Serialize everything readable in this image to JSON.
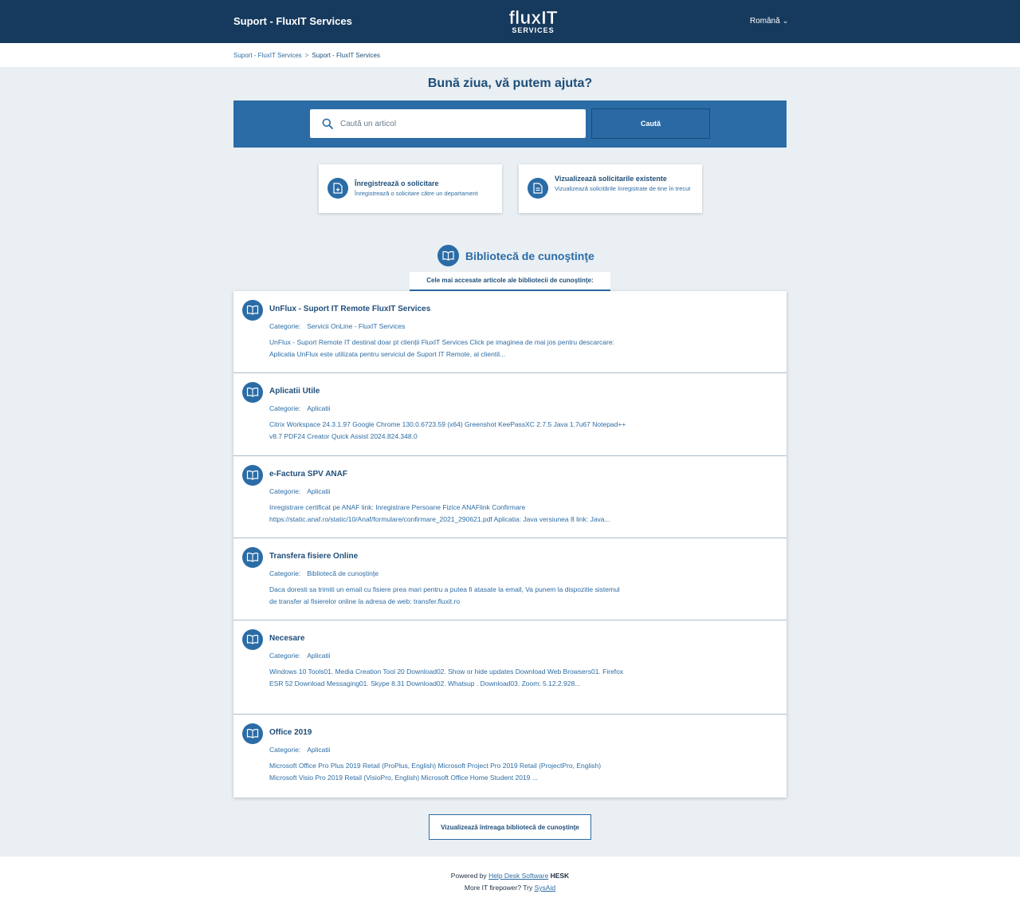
{
  "header": {
    "site_title": "Suport - FluxIT Services",
    "logo_text": "fluxIT",
    "logo_sub": "SERVICES",
    "language": "Română"
  },
  "breadcrumb": {
    "items": [
      "Suport - FluxIT Services",
      "Suport - FluxIT Services"
    ]
  },
  "greeting": "Bună ziua, vă putem ajuta?",
  "search": {
    "placeholder": "Caută un articol",
    "button_label": "Caută"
  },
  "actions": [
    {
      "title": "Înregistrează o solicitare",
      "description": "Înregistrează o solicitare către un departament"
    },
    {
      "title": "Vizualizează solicitarile existente",
      "description": "Vizualizează solicitările înregistrate de tine în trecut"
    }
  ],
  "knowledgebase": {
    "title": "Bibliotecă de cunoştinţe",
    "tab_label": "Cele mai accesate articole ale bibliotecii de cunoştinţe:",
    "category_label": "Categorie:",
    "view_all_label": "Vizualizează întreaga bibliotecă de cunoştinţe",
    "articles": [
      {
        "title": "UnFlux - Suport IT Remote FluxIT Services",
        "category": "Servicii OnLine - FluxIT Services",
        "preview": "UnFlux - Suport Remote IT destinat doar pt clienții FluxIT Services Click pe imaginea de mai jos pentru descarcare:  Aplicatia UnFlux este utilizata pentru serviciul de Suport IT Remote, al clientil..."
      },
      {
        "title": "Aplicatii Utile",
        "category": "Aplicatii",
        "preview": "Citrix Workspace 24.3.1.97 Google Chrome 130.0.6723.59 (x64) Greenshot KeePassXC 2.7.5 Java 1.7u67 Notepad++ v8.7 PDF24 Creator Quick Assist 2024.824.348.0"
      },
      {
        "title": "e-Factura SPV ANAF",
        "category": "Aplicatii",
        "preview": "Inregistrare certificat pe ANAF link: Inregistrare Persoane Fizice ANAFlink Confirmare https://static.anaf.ro/static/10/Anaf/formulare/confirmare_2021_290621.pdf Aplicatia: Java versiunea 8 link: Java..."
      },
      {
        "title": "Transfera fisiere Online",
        "category": "Bibliotecă de cunoştinţe",
        "preview": "Daca doresti sa trimiti un email cu fisiere prea mari pentru a putea fi atasate la email, Va punem la dispozitie sistemul de transfer al fisierelor online la adresa de web: transfer.fluxit.ro"
      },
      {
        "title": "Necesare",
        "category": "Aplicatii",
        "preview": "Windows 10 Tools01. Media Creation Tool 20 Download02. Show or hide updates Download Web Browsers01. Firefox ESR 52 Download Messaging01. Skype 8.31 Download02. Whatsup . Download03. Zoom: 5.12.2.928..."
      },
      {
        "title": "Office 2019",
        "category": "Aplicatii",
        "preview": "Microsoft Office Pro Plus 2019 Retail (ProPlus, English) Microsoft Project Pro 2019 Retail (ProjectPro, English) Microsoft Visio Pro 2019 Retail (VisioPro, English) Microsoft Office Home Student 2019 ..."
      }
    ]
  },
  "footer": {
    "powered_by": "Powered by",
    "help_desk_link": "Help Desk Software",
    "brand": "HESK",
    "more_it": "More IT firepower? Try",
    "sysaid_link": "SysAid"
  },
  "colors": {
    "header_bg": "#163a5e",
    "accent": "#2b6ca6",
    "page_bg": "#e9eff3"
  }
}
